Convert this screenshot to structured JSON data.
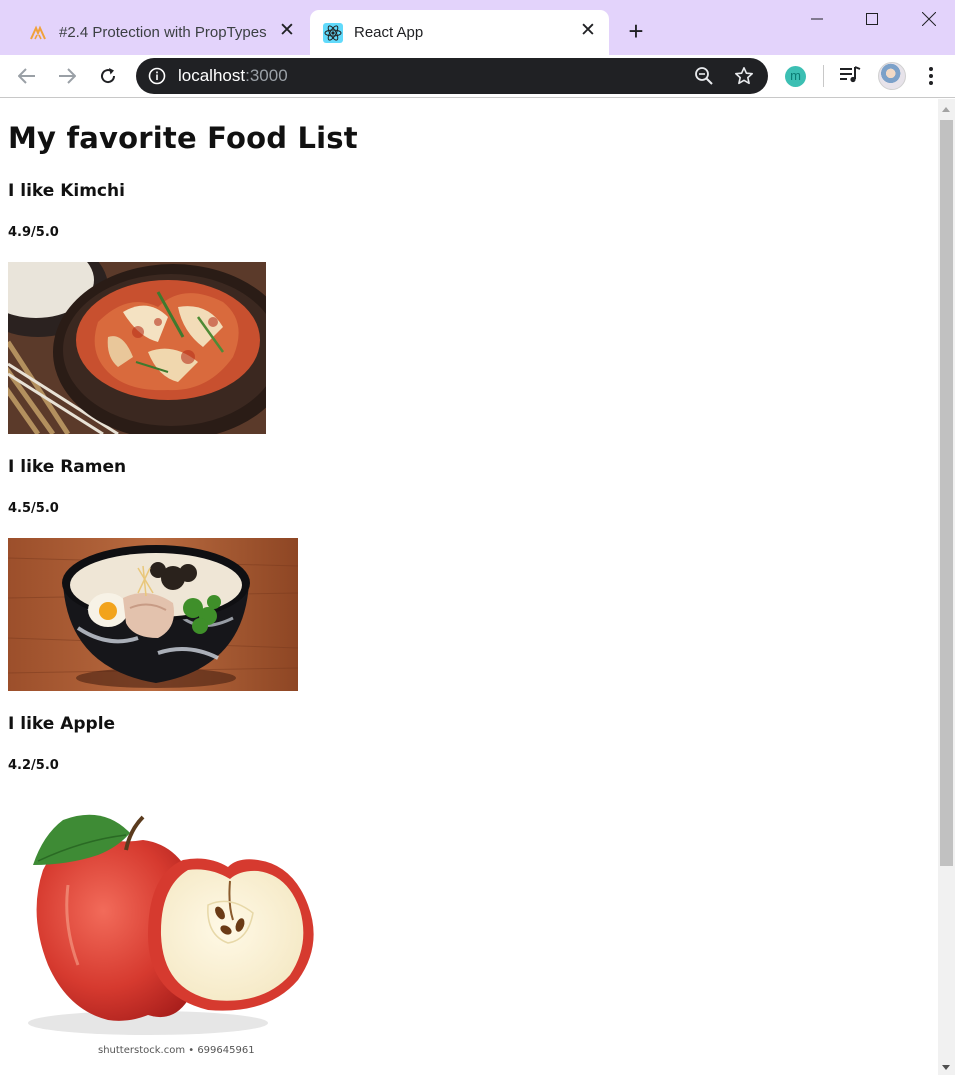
{
  "browser": {
    "tabs": [
      {
        "title": "#2.4 Protection with PropTypes",
        "favicon": "nomad-logo-icon",
        "active": false
      },
      {
        "title": "React App",
        "favicon": "react-logo-icon",
        "active": true
      }
    ],
    "address": {
      "host": "localhost",
      "port": ":3000"
    },
    "extension_letter": "m",
    "accent_color": "#e3d3fb"
  },
  "page": {
    "heading": "My favorite Food List",
    "foods": [
      {
        "name": "I like Kimchi",
        "rating": "4.9/5.0",
        "image": "kimchi-image"
      },
      {
        "name": "I like Ramen",
        "rating": "4.5/5.0",
        "image": "ramen-image"
      },
      {
        "name": "I like Apple",
        "rating": "4.2/5.0",
        "image": "apple-image",
        "image_watermark": "shutterstock.com • 699645961"
      }
    ]
  }
}
